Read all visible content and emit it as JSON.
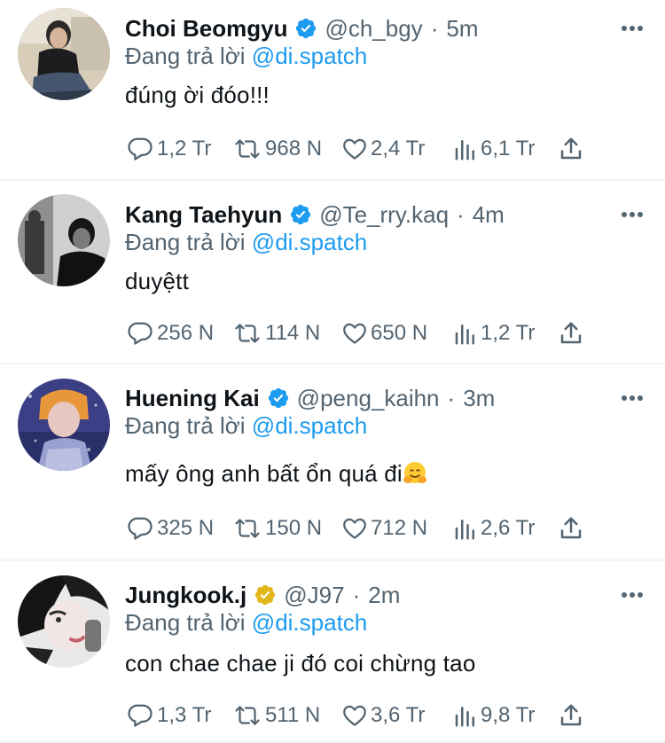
{
  "colors": {
    "accent": "#1d9bf0",
    "text": "#0f1419",
    "muted": "#536471",
    "divider": "#eff3f4",
    "gold_badge": "#e2b719"
  },
  "tweets": [
    {
      "name": "Choi Beomgyu",
      "handle": "@ch_bgy",
      "time": "5m",
      "reply_prefix": "Đang trả lời",
      "reply_to": "@di.spatch",
      "text": "đúng ời đóo!!!",
      "badge": "blue-verified-icon",
      "replies": "1,2 Tr",
      "retweets": "968 N",
      "likes": "2,4 Tr",
      "views": "6,1 Tr"
    },
    {
      "name": "Kang Taehyun",
      "handle": "@Te_rry.kaq",
      "time": "4m",
      "reply_prefix": "Đang trả lời",
      "reply_to": "@di.spatch",
      "text": "duyệtt",
      "badge": "blue-verified-icon",
      "replies": "256 N",
      "retweets": "114 N",
      "likes": "650 N",
      "views": "1,2 Tr"
    },
    {
      "name": "Huening Kai",
      "handle": "@peng_kaihn",
      "time": "3m",
      "reply_prefix": "Đang trả lời",
      "reply_to": "@di.spatch",
      "text": "mấy ông anh bất ổn quá đi",
      "emoji": "hugging-face-emoji",
      "badge": "blue-verified-icon",
      "replies": "325 N",
      "retweets": "150 N",
      "likes": "712 N",
      "views": "2,6 Tr"
    },
    {
      "name": "Jungkook.j",
      "handle": "@J97",
      "time": "2m",
      "reply_prefix": "Đang trả lời",
      "reply_to": "@di.spatch",
      "text": "con chae chae ji đó coi chừng tao",
      "badge": "gold-verified-icon",
      "replies": "1,3 Tr",
      "retweets": "511 N",
      "likes": "3,6 Tr",
      "views": "9,8 Tr"
    }
  ]
}
